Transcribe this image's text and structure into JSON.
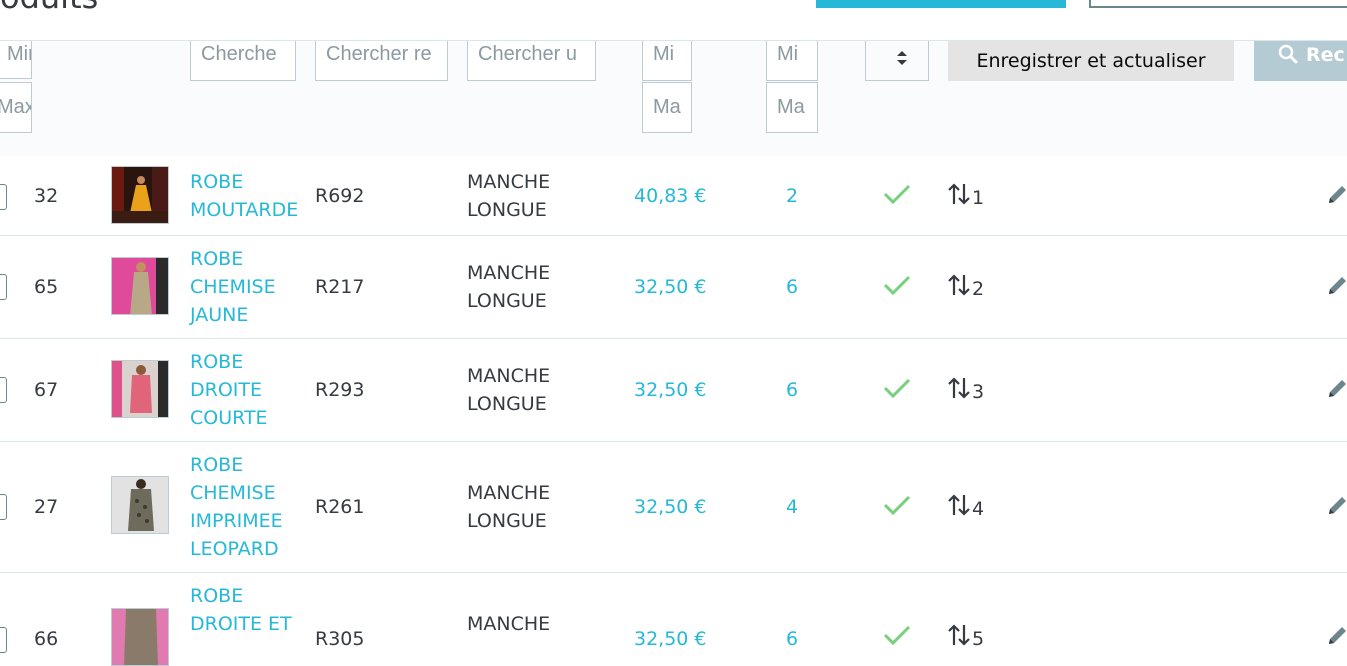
{
  "header": {
    "title": "oduits"
  },
  "filters": {
    "id_min": "Min",
    "id_max": "Max",
    "name": "Cherche",
    "reference": "Chercher re",
    "category": "Chercher u",
    "price_min": "Mi",
    "price_max": "Ma",
    "qty_min": "Mi",
    "qty_max": "Ma",
    "save_label": "Enregistrer et actualiser",
    "search_label": "Rec"
  },
  "products": [
    {
      "id": "32",
      "name_lines": [
        "ROBE",
        "MOUTARDE"
      ],
      "reference": "R692",
      "category_lines": [
        "MANCHE",
        "LONGUE"
      ],
      "price": "40,83 €",
      "quantity": "2",
      "position": "1"
    },
    {
      "id": "65",
      "name_lines": [
        "ROBE",
        "CHEMISE",
        "JAUNE"
      ],
      "reference": "R217",
      "category_lines": [
        "MANCHE",
        "LONGUE"
      ],
      "price": "32,50 €",
      "quantity": "6",
      "position": "2"
    },
    {
      "id": "67",
      "name_lines": [
        "ROBE",
        "DROITE",
        "COURTE"
      ],
      "reference": "R293",
      "category_lines": [
        "MANCHE",
        "LONGUE"
      ],
      "price": "32,50 €",
      "quantity": "6",
      "position": "3"
    },
    {
      "id": "27",
      "name_lines": [
        "ROBE",
        "CHEMISE",
        "IMPRIMEE",
        "LEOPARD"
      ],
      "reference": "R261",
      "category_lines": [
        "MANCHE",
        "LONGUE"
      ],
      "price": "32,50 €",
      "quantity": "4",
      "position": "4"
    },
    {
      "id": "66",
      "name_lines": [
        "ROBE",
        "DROITE ET"
      ],
      "reference": "R305",
      "category_lines": [
        "MANCHE"
      ],
      "price": "32,50 €",
      "quantity": "6",
      "position": "5"
    }
  ],
  "colors": {
    "accent": "#25b9d7",
    "status_ok": "#78d07d",
    "border": "#bbcdd2"
  },
  "icons": {
    "status": "check-icon",
    "position": "arrows-up-down-icon",
    "edit": "pencil-icon",
    "search": "search-icon",
    "sort": "sort-icon"
  }
}
